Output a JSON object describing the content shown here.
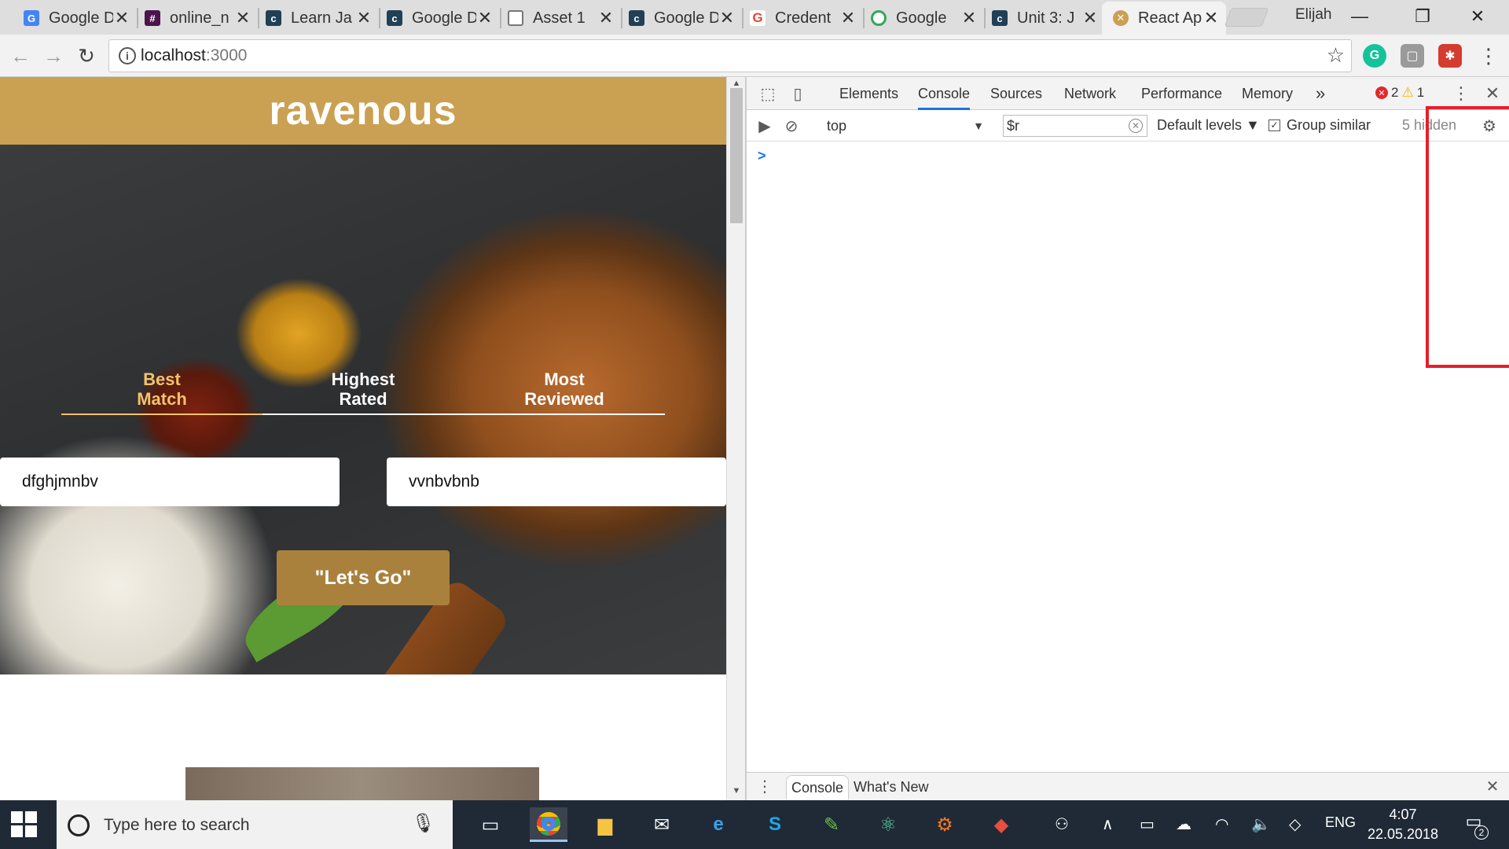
{
  "browser": {
    "tabs": [
      {
        "title": "Google D",
        "favicon": "google-docs-icon",
        "color": "#4285f4"
      },
      {
        "title": "online_n",
        "favicon": "hash-icon",
        "color": "#4a154b"
      },
      {
        "title": "Learn Ja",
        "favicon": "codecademy-icon",
        "color": "#204056"
      },
      {
        "title": "Google D",
        "favicon": "codecademy-icon",
        "color": "#204056"
      },
      {
        "title": "Asset 1",
        "favicon": "file-icon",
        "color": "#777777"
      },
      {
        "title": "Google D",
        "favicon": "codecademy-icon",
        "color": "#204056"
      },
      {
        "title": "Credent",
        "favicon": "google-g-icon",
        "color": "#ea4335"
      },
      {
        "title": "Google",
        "favicon": "google-cloud-icon",
        "color": "#34a853"
      },
      {
        "title": "Unit 3: J",
        "favicon": "codecademy-icon",
        "color": "#204056"
      },
      {
        "title": "React Ap",
        "favicon": "react-app-icon",
        "color": "#caa052"
      }
    ],
    "tab_close_glyph": "✕",
    "active_tab_index": 9,
    "profile_name": "Elijah",
    "address": {
      "host": "localhost",
      "port": ":3000"
    }
  },
  "page": {
    "logo": "ravenous",
    "sort_options": [
      {
        "line1": "Best",
        "line2": "Match"
      },
      {
        "line1": "Highest",
        "line2": "Rated"
      },
      {
        "line1": "Most",
        "line2": "Reviewed"
      }
    ],
    "active_sort_index": 0,
    "term_value": "dfghjmnbv",
    "location_value": "vvnbvbnb",
    "go_label": "\"Let's Go\""
  },
  "devtools": {
    "tabs": [
      "Elements",
      "Console",
      "Sources",
      "Network",
      "Performance",
      "Memory"
    ],
    "active_tab": "Console",
    "overflow_glyph": "»",
    "error_count": "2",
    "warning_count": "1",
    "context": "top",
    "filter_value": "$r",
    "levels_label": "Default levels ▼",
    "group_similar_label": "Group similar",
    "hidden_label": "5 hidden",
    "prompt_glyph": ">",
    "drawer_tabs": [
      "Console",
      "What's New"
    ],
    "highlight_color": "#e3202b"
  },
  "taskbar": {
    "search_placeholder": "Type here to search",
    "language": "ENG",
    "time": "4:07",
    "date": "22.05.2018",
    "notification_count": "2"
  }
}
